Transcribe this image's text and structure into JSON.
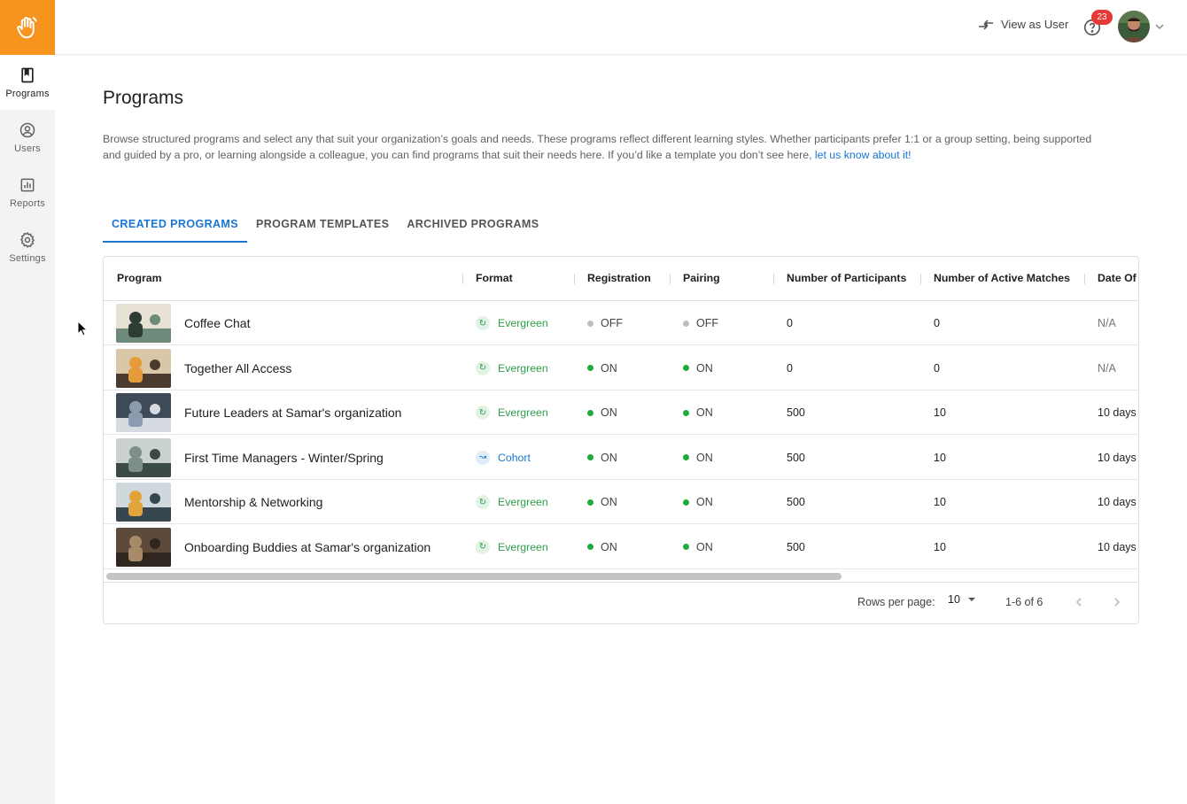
{
  "nav": {
    "items": [
      {
        "label": "Programs",
        "icon": "book-icon"
      },
      {
        "label": "Users",
        "icon": "user-circle-icon"
      },
      {
        "label": "Reports",
        "icon": "bar-chart-icon"
      },
      {
        "label": "Settings",
        "icon": "gear-icon"
      }
    ],
    "active": "Programs"
  },
  "topbar": {
    "view_as_user": "View as User",
    "help_badge_count": "23"
  },
  "page": {
    "title": "Programs",
    "description": "Browse structured programs and select any that suit your organization’s goals and needs. These programs reflect different learning styles. Whether participants prefer 1:1 or a group setting, being supported and guided by a pro, or learning alongside a colleague, you can find programs that suit their needs here. If you’d like a template you don’t see here, ",
    "description_link": "let us know about it!"
  },
  "tabs": [
    {
      "label": "CREATED PROGRAMS",
      "active": true
    },
    {
      "label": "PROGRAM TEMPLATES",
      "active": false
    },
    {
      "label": "ARCHIVED PROGRAMS",
      "active": false
    }
  ],
  "table": {
    "columns": [
      "Program",
      "Format",
      "Registration",
      "Pairing",
      "Number of Participants",
      "Number of Active Matches",
      "Date Of"
    ],
    "rows": [
      {
        "program": "Coffee Chat",
        "format": "Evergreen",
        "registration": "OFF",
        "pairing": "OFF",
        "participants": "0",
        "matches": "0",
        "date": "N/A"
      },
      {
        "program": "Together All Access",
        "format": "Evergreen",
        "registration": "ON",
        "pairing": "ON",
        "participants": "0",
        "matches": "0",
        "date": "N/A"
      },
      {
        "program": "Future Leaders at Samar's organization",
        "format": "Evergreen",
        "registration": "ON",
        "pairing": "ON",
        "participants": "500",
        "matches": "10",
        "date": "10 days"
      },
      {
        "program": "First Time Managers - Winter/Spring",
        "format": "Cohort",
        "registration": "ON",
        "pairing": "ON",
        "participants": "500",
        "matches": "10",
        "date": "10 days"
      },
      {
        "program": "Mentorship & Networking",
        "format": "Evergreen",
        "registration": "ON",
        "pairing": "ON",
        "participants": "500",
        "matches": "10",
        "date": "10 days"
      },
      {
        "program": "Onboarding Buddies at Samar's organization",
        "format": "Evergreen",
        "registration": "ON",
        "pairing": "ON",
        "participants": "500",
        "matches": "10",
        "date": "10 days"
      }
    ]
  },
  "pagination": {
    "rows_per_page_label": "Rows per page:",
    "rows_per_page": "10",
    "range": "1-6 of 6"
  },
  "colors": {
    "brand": "#f7941d",
    "accent": "#1976d2",
    "on": "#1faa3a",
    "off": "#bdbdbd",
    "evergreen": "#2e9e47",
    "cohort": "#1976d2"
  }
}
